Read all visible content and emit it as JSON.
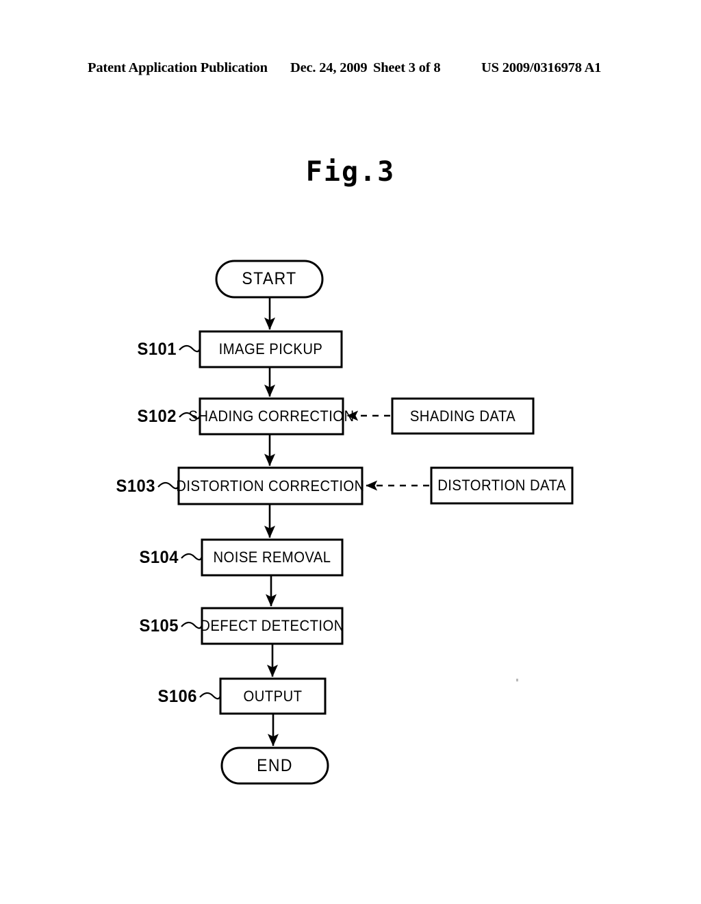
{
  "header": {
    "publication": "Patent Application Publication",
    "date": "Dec. 24, 2009",
    "sheet": "Sheet 3 of 8",
    "patent_number": "US 2009/0316978 A1"
  },
  "figure": {
    "title": "Fig.3"
  },
  "chart_data": {
    "type": "diagram",
    "diagram_type": "flowchart",
    "title": "Fig.3",
    "orientation": "top-to-bottom",
    "nodes": [
      {
        "id": "start",
        "label": "START",
        "shape": "stadium",
        "step": null
      },
      {
        "id": "s101",
        "label": "IMAGE PICKUP",
        "shape": "rectangle",
        "step": "S101"
      },
      {
        "id": "s102",
        "label": "SHADING CORRECTION",
        "shape": "rectangle",
        "step": "S102"
      },
      {
        "id": "s103",
        "label": "DISTORTION CORRECTION",
        "shape": "rectangle",
        "step": "S103"
      },
      {
        "id": "s104",
        "label": "NOISE REMOVAL",
        "shape": "rectangle",
        "step": "S104"
      },
      {
        "id": "s105",
        "label": "DEFECT DETECTION",
        "shape": "rectangle",
        "step": "S105"
      },
      {
        "id": "s106",
        "label": "OUTPUT",
        "shape": "rectangle",
        "step": "S106"
      },
      {
        "id": "end",
        "label": "END",
        "shape": "stadium",
        "step": null
      },
      {
        "id": "shading_data",
        "label": "SHADING DATA",
        "shape": "rectangle",
        "step": null
      },
      {
        "id": "distortion_data",
        "label": "DISTORTION DATA",
        "shape": "rectangle",
        "step": null
      }
    ],
    "edges": [
      {
        "from": "start",
        "to": "s101",
        "style": "solid"
      },
      {
        "from": "s101",
        "to": "s102",
        "style": "solid"
      },
      {
        "from": "s102",
        "to": "s103",
        "style": "solid"
      },
      {
        "from": "s103",
        "to": "s104",
        "style": "solid"
      },
      {
        "from": "s104",
        "to": "s105",
        "style": "solid"
      },
      {
        "from": "s105",
        "to": "s106",
        "style": "solid"
      },
      {
        "from": "s106",
        "to": "end",
        "style": "solid"
      },
      {
        "from": "shading_data",
        "to": "s102",
        "style": "dashed"
      },
      {
        "from": "distortion_data",
        "to": "s103",
        "style": "dashed"
      }
    ],
    "colors": {
      "stroke": "#000000",
      "fill": "#ffffff",
      "text": "#000000"
    }
  },
  "labels": {
    "start": "START",
    "end": "END",
    "s101": "IMAGE PICKUP",
    "s102": "SHADING CORRECTION",
    "s103": "DISTORTION CORRECTION",
    "s104": "NOISE REMOVAL",
    "s105": "DEFECT DETECTION",
    "s106": "OUTPUT",
    "shading_data": "SHADING DATA",
    "distortion_data": "DISTORTION DATA"
  },
  "steps": {
    "s101": "S101",
    "s102": "S102",
    "s103": "S103",
    "s104": "S104",
    "s105": "S105",
    "s106": "S106"
  }
}
